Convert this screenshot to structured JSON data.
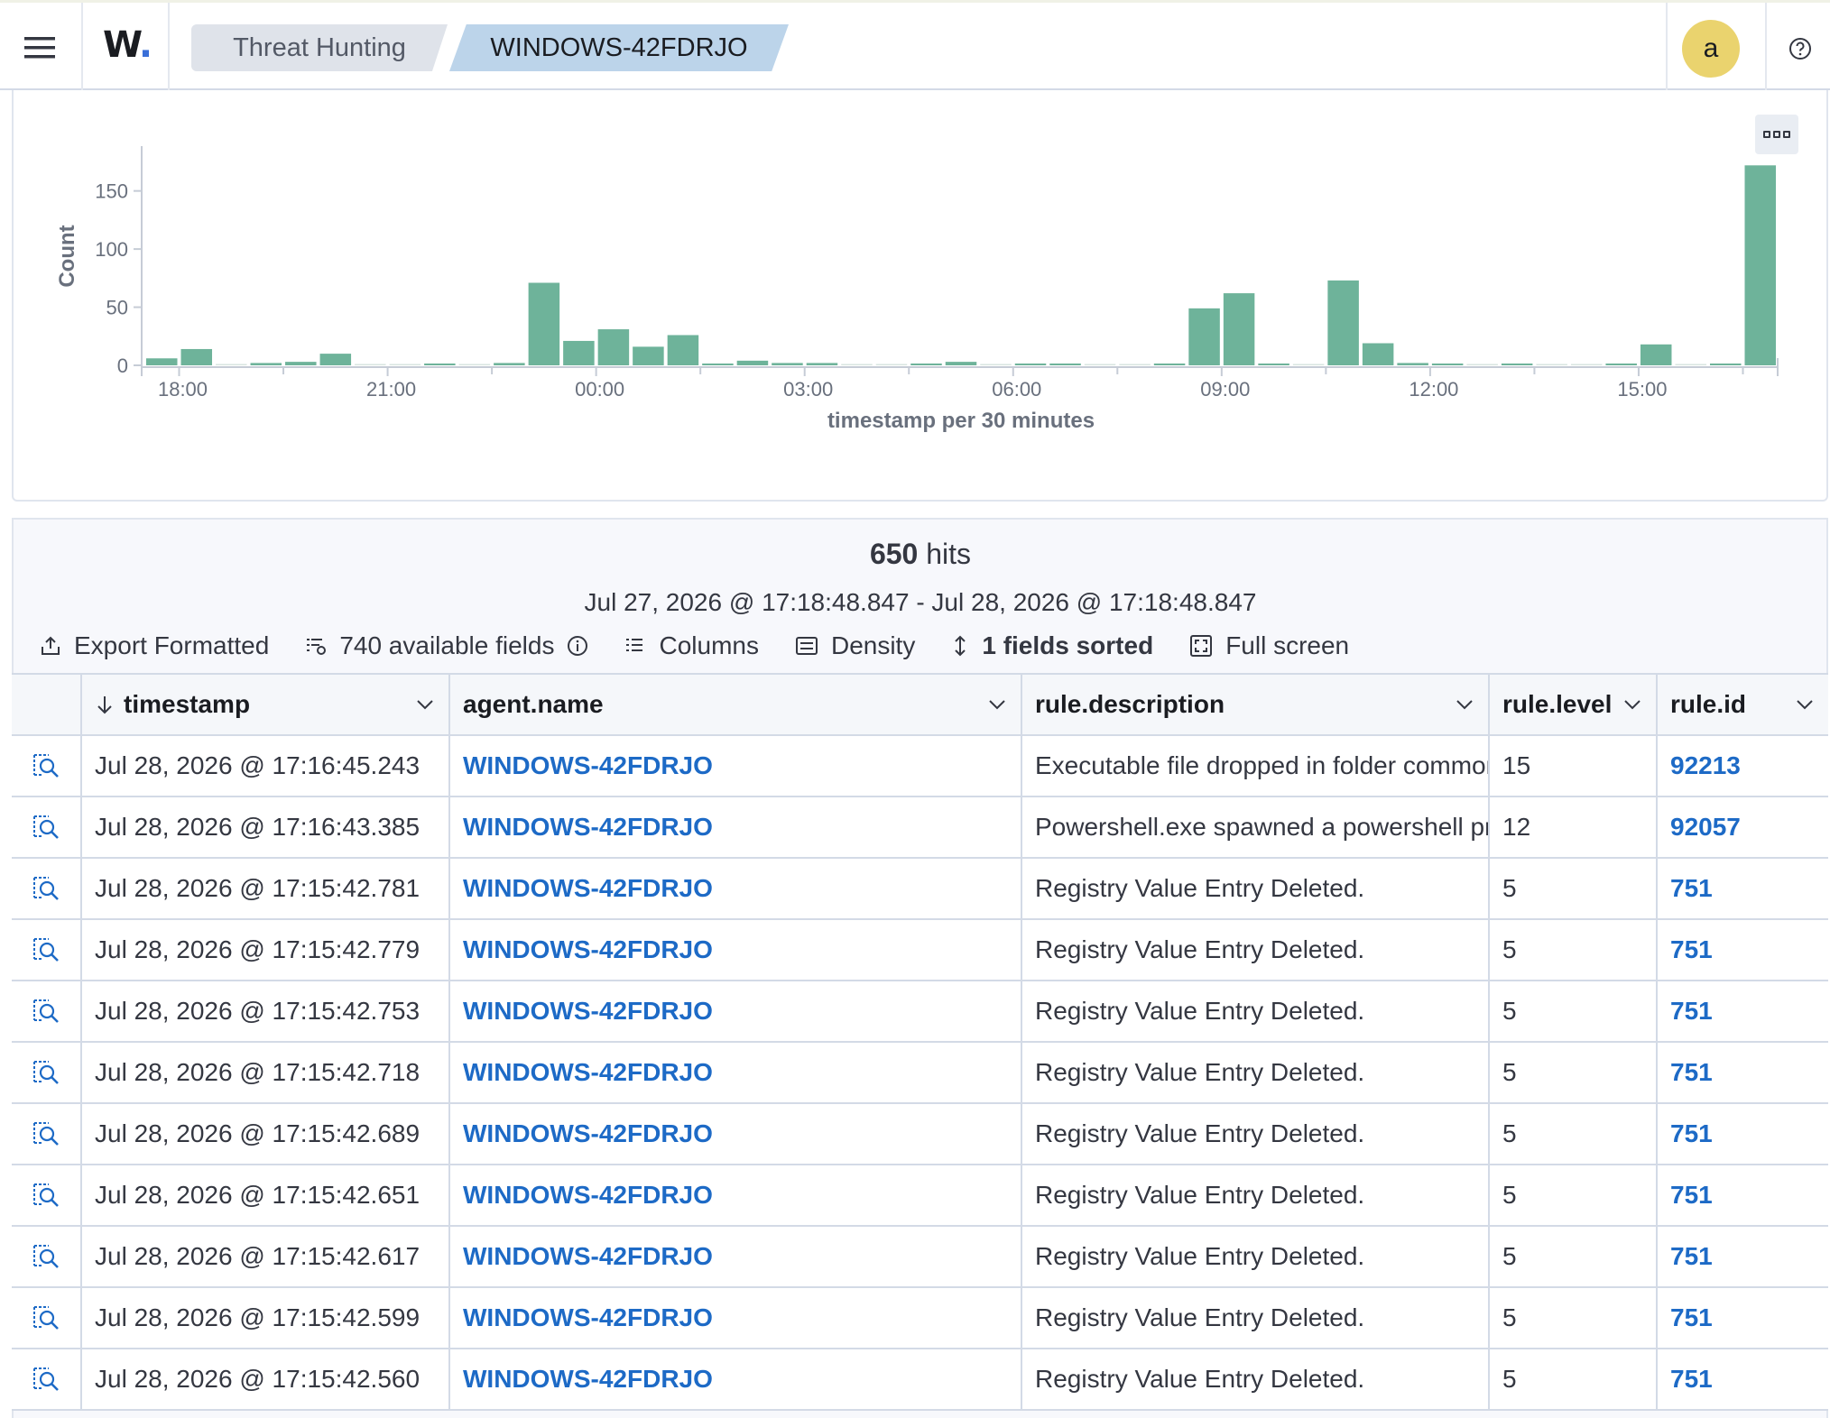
{
  "header": {
    "logo": "W",
    "logo_dot": ".",
    "breadcrumbs": [
      "Threat Hunting",
      "WINDOWS-42FDRJO"
    ],
    "avatar_initial": "a",
    "icons": [
      "menu-icon",
      "help-icon"
    ]
  },
  "chart_data": {
    "type": "bar",
    "xlabel": "timestamp per 30 minutes",
    "ylabel": "Count",
    "ylim": [
      0,
      180
    ],
    "yticks": [
      0,
      50,
      100,
      150
    ],
    "xtick_labels": [
      "18:00",
      "21:00",
      "00:00",
      "03:00",
      "06:00",
      "09:00",
      "12:00",
      "15:00"
    ],
    "start_time": "17:30",
    "bin_minutes": 30,
    "values": [
      6,
      14,
      0,
      2,
      3,
      10,
      0,
      0,
      1,
      0,
      2,
      71,
      21,
      31,
      16,
      26,
      1,
      4,
      2,
      2,
      0,
      0,
      1,
      3,
      0,
      1,
      1,
      0,
      0,
      1,
      49,
      62,
      1,
      0,
      73,
      19,
      2,
      1,
      0,
      1,
      0,
      0,
      1,
      18,
      0,
      1,
      172
    ],
    "grid": false,
    "legend": "none",
    "color": "#6eb39a"
  },
  "hits": {
    "count": "650",
    "label": "hits",
    "range": "Jul 27, 2026 @ 17:18:48.847 - Jul 28, 2026 @ 17:18:48.847"
  },
  "toolbar": {
    "export": "Export Formatted",
    "fields": "740 available fields",
    "columns": "Columns",
    "density": "Density",
    "sorted": "1 fields sorted",
    "fullscreen": "Full screen"
  },
  "table": {
    "columns": [
      "timestamp",
      "agent.name",
      "rule.description",
      "rule.level",
      "rule.id"
    ],
    "rows": [
      {
        "timestamp": "Jul 28, 2026 @ 17:16:45.243",
        "agent": "WINDOWS-42FDRJO",
        "description": "Executable file dropped in folder commonly used by malware",
        "level": "15",
        "id": "92213"
      },
      {
        "timestamp": "Jul 28, 2026 @ 17:16:43.385",
        "agent": "WINDOWS-42FDRJO",
        "description": "Powershell.exe spawned a powershell process",
        "level": "12",
        "id": "92057"
      },
      {
        "timestamp": "Jul 28, 2026 @ 17:15:42.781",
        "agent": "WINDOWS-42FDRJO",
        "description": "Registry Value Entry Deleted.",
        "level": "5",
        "id": "751"
      },
      {
        "timestamp": "Jul 28, 2026 @ 17:15:42.779",
        "agent": "WINDOWS-42FDRJO",
        "description": "Registry Value Entry Deleted.",
        "level": "5",
        "id": "751"
      },
      {
        "timestamp": "Jul 28, 2026 @ 17:15:42.753",
        "agent": "WINDOWS-42FDRJO",
        "description": "Registry Value Entry Deleted.",
        "level": "5",
        "id": "751"
      },
      {
        "timestamp": "Jul 28, 2026 @ 17:15:42.718",
        "agent": "WINDOWS-42FDRJO",
        "description": "Registry Value Entry Deleted.",
        "level": "5",
        "id": "751"
      },
      {
        "timestamp": "Jul 28, 2026 @ 17:15:42.689",
        "agent": "WINDOWS-42FDRJO",
        "description": "Registry Value Entry Deleted.",
        "level": "5",
        "id": "751"
      },
      {
        "timestamp": "Jul 28, 2026 @ 17:15:42.651",
        "agent": "WINDOWS-42FDRJO",
        "description": "Registry Value Entry Deleted.",
        "level": "5",
        "id": "751"
      },
      {
        "timestamp": "Jul 28, 2026 @ 17:15:42.617",
        "agent": "WINDOWS-42FDRJO",
        "description": "Registry Value Entry Deleted.",
        "level": "5",
        "id": "751"
      },
      {
        "timestamp": "Jul 28, 2026 @ 17:15:42.599",
        "agent": "WINDOWS-42FDRJO",
        "description": "Registry Value Entry Deleted.",
        "level": "5",
        "id": "751"
      },
      {
        "timestamp": "Jul 28, 2026 @ 17:15:42.560",
        "agent": "WINDOWS-42FDRJO",
        "description": "Registry Value Entry Deleted.",
        "level": "5",
        "id": "751"
      }
    ]
  }
}
